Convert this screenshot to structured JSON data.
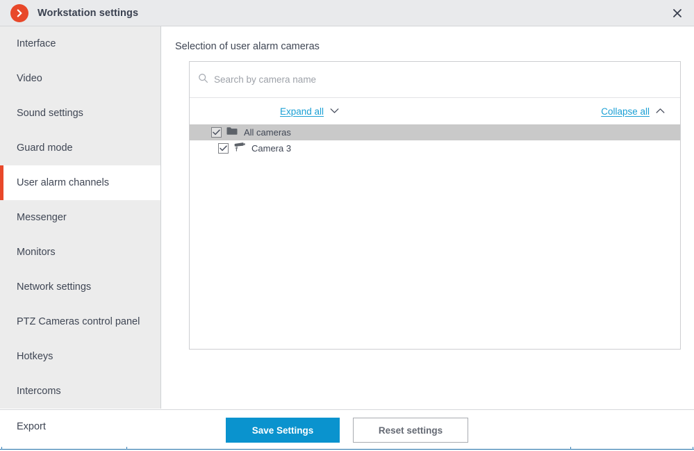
{
  "titlebar": {
    "app_icon": "orange-chevron-right-icon",
    "title": "Workstation settings",
    "close_icon": "close-icon"
  },
  "sidebar": {
    "items": [
      {
        "label": "Interface",
        "active": false
      },
      {
        "label": "Video",
        "active": false
      },
      {
        "label": "Sound settings",
        "active": false
      },
      {
        "label": "Guard mode",
        "active": false
      },
      {
        "label": "User alarm channels",
        "active": true
      },
      {
        "label": "Messenger",
        "active": false
      },
      {
        "label": "Monitors",
        "active": false
      },
      {
        "label": "Network settings",
        "active": false
      },
      {
        "label": "PTZ Cameras control panel",
        "active": false
      },
      {
        "label": "Hotkeys",
        "active": false
      },
      {
        "label": "Intercoms",
        "active": false
      }
    ],
    "overflow_item": "Export"
  },
  "content": {
    "title": "Selection of user alarm cameras",
    "search": {
      "placeholder": "Search by camera name",
      "value": "",
      "icon": "search-icon"
    },
    "expand_all": {
      "label": "Expand all",
      "icon": "chevron-down-icon"
    },
    "collapse_all": {
      "label": "Collapse all",
      "icon": "chevron-up-icon"
    },
    "tree": [
      {
        "label": "All cameras",
        "level": 0,
        "checked": true,
        "selected": true,
        "icon": "folder-icon"
      },
      {
        "label": "Camera 3",
        "level": 1,
        "checked": true,
        "selected": false,
        "icon": "cctv-camera-icon"
      }
    ]
  },
  "footer": {
    "save_label": "Save Settings",
    "reset_label": "Reset settings"
  },
  "colors": {
    "accent_orange": "#e8482a",
    "link_blue": "#1a9fd4",
    "primary_button_blue": "#0a93ce",
    "sidebar_bg": "#ececec",
    "selected_row": "#c9c9c9",
    "text": "#3f4654"
  }
}
